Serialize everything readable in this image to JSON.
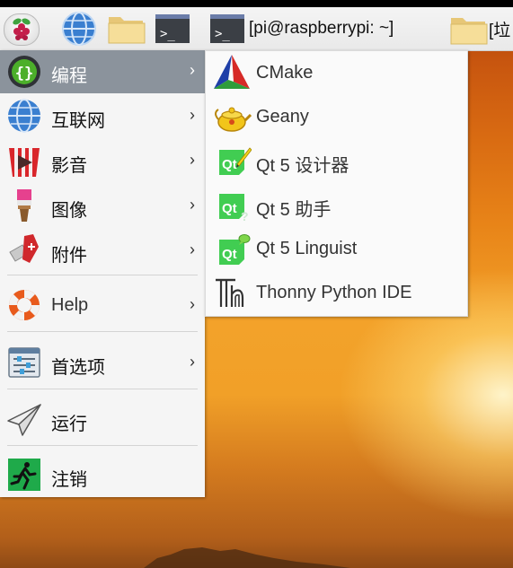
{
  "taskbar": {
    "terminal_title": "[pi@raspberrypi: ~]",
    "folder_title": "[垃"
  },
  "main_menu": {
    "items": [
      {
        "label": "编程",
        "icon": "programming-icon",
        "has_submenu": true
      },
      {
        "label": "互联网",
        "icon": "globe-icon",
        "has_submenu": true
      },
      {
        "label": "影音",
        "icon": "sound-video-icon",
        "has_submenu": true
      },
      {
        "label": "图像",
        "icon": "graphics-icon",
        "has_submenu": true
      },
      {
        "label": "附件",
        "icon": "accessories-icon",
        "has_submenu": true
      },
      {
        "label": "Help",
        "icon": "help-lifebuoy-icon",
        "has_submenu": true
      },
      {
        "label": "首选项",
        "icon": "preferences-icon",
        "has_submenu": true
      },
      {
        "label": "运行",
        "icon": "run-icon",
        "has_submenu": false
      },
      {
        "label": "注销",
        "icon": "logout-icon",
        "has_submenu": false
      }
    ],
    "arrow": "›"
  },
  "submenu": {
    "items": [
      {
        "label": "CMake",
        "icon": "cmake-icon"
      },
      {
        "label": "Geany",
        "icon": "geany-icon"
      },
      {
        "label": "Qt 5 设计器",
        "icon": "qt-designer-icon"
      },
      {
        "label": "Qt 5 助手",
        "icon": "qt-assistant-icon"
      },
      {
        "label": "Qt 5 Linguist",
        "icon": "qt-linguist-icon"
      },
      {
        "label": "Thonny Python IDE",
        "icon": "thonny-icon"
      }
    ]
  },
  "colors": {
    "menu_bg": "#f5f5f5",
    "selected_bg": "#8b939c",
    "qt_green": "#41cd52"
  }
}
